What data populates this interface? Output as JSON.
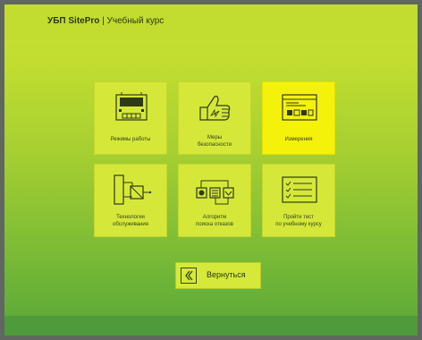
{
  "header": {
    "brand": "УБП SitePro",
    "separator": " | ",
    "course": "Учебный курс"
  },
  "menu": {
    "tiles": [
      {
        "label": "Режимы работы",
        "icon": "device-panel-icon"
      },
      {
        "label": "Меры\nбезопасности",
        "icon": "thumbs-up-icon"
      },
      {
        "label": "Измерения",
        "icon": "measurement-window-icon",
        "active": true
      },
      {
        "label": "Технологии\nобслуживания",
        "icon": "circuit-diagram-icon"
      },
      {
        "label": "Алгоритм\nпоиска отказов",
        "icon": "algorithm-flow-icon"
      },
      {
        "label": "Пройти тест\nпо учебному курсу",
        "icon": "checklist-icon"
      }
    ]
  },
  "back_button": {
    "label": "Вернуться",
    "icon": "chevron-left-icon"
  },
  "colors": {
    "tile": "#d5e83a",
    "tile_active": "#f4f20b",
    "header": "#c2dc2f",
    "text": "#33401a"
  }
}
